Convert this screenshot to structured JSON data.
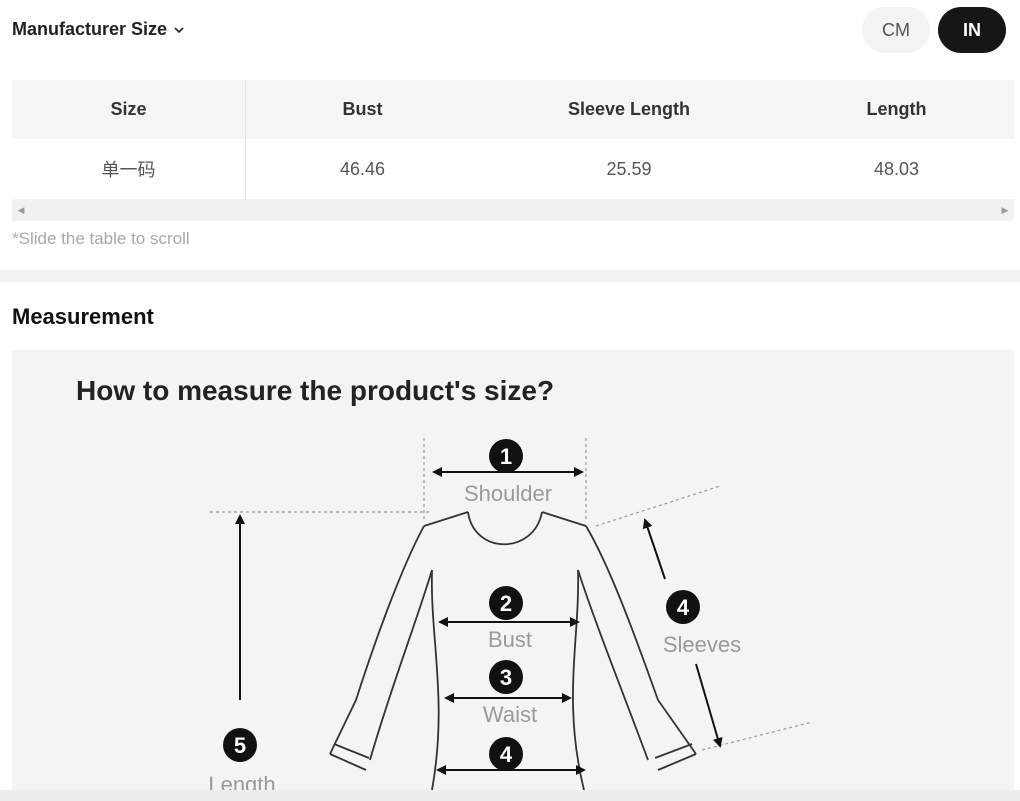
{
  "header": {
    "size_selector_label": "Manufacturer Size",
    "units": [
      {
        "label": "CM",
        "selected": false
      },
      {
        "label": "IN",
        "selected": true
      }
    ]
  },
  "table": {
    "columns": [
      "Size",
      "Bust",
      "Sleeve Length",
      "Length"
    ],
    "rows": [
      [
        "单一码",
        "46.46",
        "25.59",
        "48.03"
      ]
    ]
  },
  "scroll_hint": "*Slide the table to scroll",
  "measurement": {
    "section_title": "Measurement",
    "diagram_title": "How to measure the product's size?",
    "points": [
      {
        "number": "1",
        "label": "Shoulder"
      },
      {
        "number": "2",
        "label": "Bust"
      },
      {
        "number": "3",
        "label": "Waist"
      },
      {
        "number": "4",
        "label": "Sleeves"
      },
      {
        "number": "4",
        "label": ""
      },
      {
        "number": "5",
        "label": "Length"
      }
    ]
  },
  "colors": {
    "selected_unit_bg": "#161616",
    "unselected_unit_bg": "#f3f3f3",
    "table_header_bg": "#f5f5f5",
    "diagram_bg": "#f4f4f4"
  }
}
